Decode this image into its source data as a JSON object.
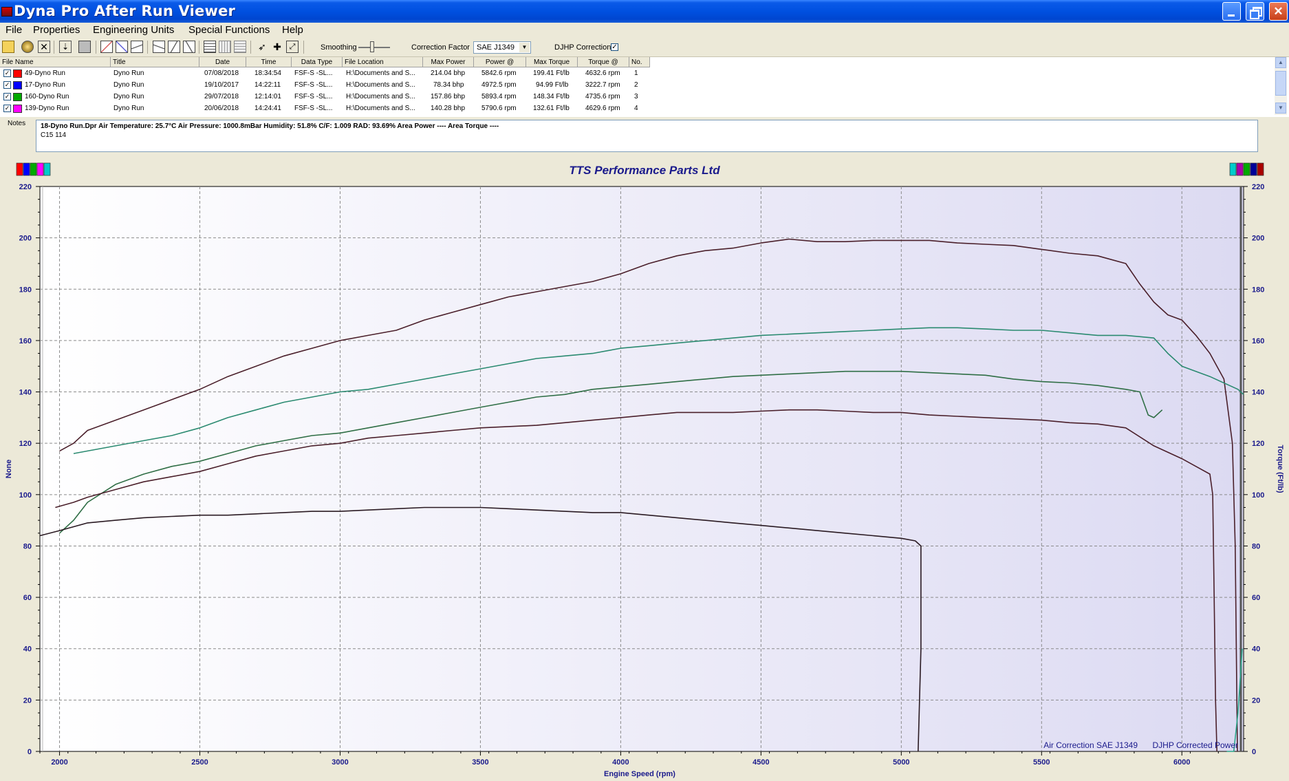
{
  "window": {
    "title": "Dyna Pro After Run Viewer",
    "minimize_glyph": "_",
    "close_glyph": "✕"
  },
  "menu": [
    {
      "label": "File"
    },
    {
      "label": "Properties"
    },
    {
      "label": "Engineering Units"
    },
    {
      "label": "Special Functions"
    },
    {
      "label": "Help"
    }
  ],
  "toolbar": {
    "smoothing_label": "Smoothing",
    "smoothing_level": 0.4,
    "correction_factor_label": "Correction Factor",
    "correction_factor_value": "SAE J1349",
    "combo_arrow": "▼",
    "djhp_label": "DJHP Correction",
    "djhp_checked": "✓",
    "icons": [
      "open-folder-icon",
      "disk-icon",
      "close-x-icon",
      "import-icon",
      "print-icon",
      "graph-icon",
      "graph-2-icon",
      "graph-3-icon",
      "graph-4-icon",
      "graph-5-icon",
      "graph-6-icon",
      "list-icon",
      "grid-icon",
      "grid-2-icon",
      "pointer-icon",
      "cross-icon",
      "zoom-icon"
    ]
  },
  "run_table": {
    "columns": [
      "File Name",
      "Title",
      "Date",
      "Time",
      "Data Type",
      "File Location",
      "Max Power",
      "Power @",
      "Max Torque",
      "Torque @",
      "No."
    ],
    "check_glyph": "✓",
    "rows": [
      {
        "file": "49-Dyno Run",
        "title": "Dyno Run",
        "date": "07/08/2018",
        "time": "18:34:54",
        "type": "FSF-S -SL...",
        "location": "H:\\Documents and S...",
        "max_power": "214.04 bhp",
        "power_at": "5842.6 rpm",
        "max_torque": "199.41 Ft/lb",
        "torque_at": "4632.6 rpm",
        "no": "1",
        "color": "#ff0000"
      },
      {
        "file": "17-Dyno Run",
        "title": "Dyno Run",
        "date": "19/10/2017",
        "time": "14:22:11",
        "type": "FSF-S -SL...",
        "location": "H:\\Documents and S...",
        "max_power": "78.34 bhp",
        "power_at": "4972.5 rpm",
        "max_torque": "94.99 Ft/lb",
        "torque_at": "3222.7 rpm",
        "no": "2",
        "color": "#0000ff"
      },
      {
        "file": "160-Dyno Run",
        "title": "Dyno Run",
        "date": "29/07/2018",
        "time": "12:14:01",
        "type": "FSF-S -SL...",
        "location": "H:\\Documents and S...",
        "max_power": "157.86 bhp",
        "power_at": "5893.4 rpm",
        "max_torque": "148.34 Ft/lb",
        "torque_at": "4735.6 rpm",
        "no": "3",
        "color": "#00aa00"
      },
      {
        "file": "139-Dyno Run",
        "title": "Dyno Run",
        "date": "20/06/2018",
        "time": "14:24:41",
        "type": "FSF-S -SL...",
        "location": "H:\\Documents and S...",
        "max_power": "140.28 bhp",
        "power_at": "5790.6 rpm",
        "max_torque": "132.61 Ft/lb",
        "torque_at": "4629.6 rpm",
        "no": "4",
        "color": "#ff00ff"
      }
    ]
  },
  "notes": {
    "label": "Notes",
    "line1": "18-Dyno Run.Dpr   Air Temperature: 25.7°C    Air Pressure: 1000.8mBar    Humidity: 51.8%    C/F: 1.009    RAD: 93.69%   Area Power ----    Area Torque ----",
    "line2": "C15 114"
  },
  "colors": {
    "left_swatches": [
      "#ff0000",
      "#0000ff",
      "#00aa00",
      "#ff00ff",
      "#00cccc"
    ],
    "right_swatches": [
      "#00cccc",
      "#aa00aa",
      "#00aa00",
      "#000099",
      "#aa0000"
    ],
    "title_blue": "#1a1a8c",
    "curve_power_1": "#4a1f2a",
    "curve_power_3": "#2a8a70",
    "curve_power_4": "#2f6e45",
    "curve_torque_1": "#4a1f2a",
    "curve_power_2": "#2a1a22",
    "curve_right_tail": "#2aa58a"
  },
  "chart_data": {
    "type": "line",
    "title": "TTS Performance Parts Ltd",
    "xlabel": "Engine Speed (rpm)",
    "ylabel": "None",
    "y2label": "Torque (Ft/lb)",
    "xlim": [
      1930,
      6220
    ],
    "ylim": [
      0,
      220
    ],
    "xticks": [
      2000,
      2500,
      3000,
      3500,
      4000,
      4500,
      5000,
      5500,
      6000
    ],
    "yticks": [
      0,
      20,
      40,
      60,
      80,
      100,
      120,
      140,
      160,
      180,
      200,
      220
    ],
    "grid": true,
    "footer_left": "Air Correction SAE J1349",
    "footer_right": "DJHP Corrected Power",
    "series": [
      {
        "color_key": "curve_power_1",
        "points": [
          [
            2000,
            117
          ],
          [
            2050,
            120
          ],
          [
            2100,
            125
          ],
          [
            2200,
            129
          ],
          [
            2300,
            133
          ],
          [
            2400,
            137
          ],
          [
            2500,
            141
          ],
          [
            2600,
            146
          ],
          [
            2700,
            150
          ],
          [
            2800,
            154
          ],
          [
            2900,
            157
          ],
          [
            3000,
            160
          ],
          [
            3100,
            162
          ],
          [
            3200,
            164
          ],
          [
            3300,
            168
          ],
          [
            3400,
            171
          ],
          [
            3500,
            174
          ],
          [
            3600,
            177
          ],
          [
            3700,
            179
          ],
          [
            3800,
            181
          ],
          [
            3900,
            183
          ],
          [
            4000,
            186
          ],
          [
            4100,
            190
          ],
          [
            4200,
            193
          ],
          [
            4300,
            195
          ],
          [
            4400,
            196
          ],
          [
            4500,
            198
          ],
          [
            4600,
            199.5
          ],
          [
            4700,
            198.5
          ],
          [
            4800,
            198.5
          ],
          [
            4900,
            199
          ],
          [
            5000,
            199
          ],
          [
            5100,
            199
          ],
          [
            5200,
            198
          ],
          [
            5300,
            197.5
          ],
          [
            5400,
            197
          ],
          [
            5500,
            195.5
          ],
          [
            5600,
            194
          ],
          [
            5700,
            193
          ],
          [
            5800,
            190
          ],
          [
            5850,
            182
          ],
          [
            5900,
            175
          ],
          [
            5950,
            170
          ],
          [
            6000,
            168
          ],
          [
            6050,
            162
          ],
          [
            6100,
            155
          ],
          [
            6150,
            145
          ],
          [
            6180,
            120
          ],
          [
            6190,
            80
          ],
          [
            6195,
            30
          ],
          [
            6198,
            0
          ]
        ]
      },
      {
        "color_key": "curve_power_3",
        "points": [
          [
            2050,
            116
          ],
          [
            2100,
            117
          ],
          [
            2200,
            119
          ],
          [
            2300,
            121
          ],
          [
            2400,
            123
          ],
          [
            2500,
            126
          ],
          [
            2600,
            130
          ],
          [
            2700,
            133
          ],
          [
            2800,
            136
          ],
          [
            2900,
            138
          ],
          [
            3000,
            140
          ],
          [
            3100,
            141
          ],
          [
            3200,
            143
          ],
          [
            3300,
            145
          ],
          [
            3400,
            147
          ],
          [
            3500,
            149
          ],
          [
            3600,
            151
          ],
          [
            3700,
            153
          ],
          [
            3800,
            154
          ],
          [
            3900,
            155
          ],
          [
            4000,
            157
          ],
          [
            4100,
            158
          ],
          [
            4200,
            159
          ],
          [
            4300,
            160
          ],
          [
            4400,
            161
          ],
          [
            4500,
            162
          ],
          [
            4600,
            162.5
          ],
          [
            4700,
            163
          ],
          [
            4800,
            163.5
          ],
          [
            4900,
            164
          ],
          [
            5000,
            164.5
          ],
          [
            5100,
            165
          ],
          [
            5200,
            165
          ],
          [
            5300,
            164.5
          ],
          [
            5400,
            164
          ],
          [
            5500,
            164
          ],
          [
            5600,
            163
          ],
          [
            5700,
            162
          ],
          [
            5800,
            162
          ],
          [
            5900,
            161
          ],
          [
            5950,
            155
          ],
          [
            6000,
            150
          ],
          [
            6100,
            146
          ],
          [
            6200,
            141
          ],
          [
            6220,
            139
          ]
        ]
      },
      {
        "color_key": "curve_power_4",
        "points": [
          [
            2000,
            85
          ],
          [
            2050,
            90
          ],
          [
            2100,
            97
          ],
          [
            2200,
            104
          ],
          [
            2300,
            108
          ],
          [
            2400,
            111
          ],
          [
            2500,
            113
          ],
          [
            2600,
            116
          ],
          [
            2700,
            119
          ],
          [
            2800,
            121
          ],
          [
            2900,
            123
          ],
          [
            3000,
            124
          ],
          [
            3100,
            126
          ],
          [
            3200,
            128
          ],
          [
            3300,
            130
          ],
          [
            3400,
            132
          ],
          [
            3500,
            134
          ],
          [
            3600,
            136
          ],
          [
            3700,
            138
          ],
          [
            3800,
            139
          ],
          [
            3900,
            141
          ],
          [
            4000,
            142
          ],
          [
            4100,
            143
          ],
          [
            4200,
            144
          ],
          [
            4300,
            145
          ],
          [
            4400,
            146
          ],
          [
            4500,
            146.5
          ],
          [
            4600,
            147
          ],
          [
            4700,
            147.5
          ],
          [
            4800,
            148
          ],
          [
            4900,
            148
          ],
          [
            5000,
            148
          ],
          [
            5100,
            147.5
          ],
          [
            5200,
            147
          ],
          [
            5300,
            146.5
          ],
          [
            5400,
            145
          ],
          [
            5500,
            144
          ],
          [
            5600,
            143.5
          ],
          [
            5700,
            142.5
          ],
          [
            5800,
            141
          ],
          [
            5850,
            140
          ],
          [
            5880,
            131
          ],
          [
            5900,
            130
          ],
          [
            5930,
            133
          ]
        ]
      },
      {
        "color_key": "curve_torque_1",
        "points": [
          [
            1985,
            95
          ],
          [
            2050,
            97
          ],
          [
            2100,
            99
          ],
          [
            2200,
            102
          ],
          [
            2300,
            105
          ],
          [
            2400,
            107
          ],
          [
            2500,
            109
          ],
          [
            2600,
            112
          ],
          [
            2700,
            115
          ],
          [
            2800,
            117
          ],
          [
            2900,
            119
          ],
          [
            3000,
            120
          ],
          [
            3100,
            122
          ],
          [
            3200,
            123
          ],
          [
            3300,
            124
          ],
          [
            3400,
            125
          ],
          [
            3500,
            126
          ],
          [
            3600,
            126.5
          ],
          [
            3700,
            127
          ],
          [
            3800,
            128
          ],
          [
            3900,
            129
          ],
          [
            4000,
            130
          ],
          [
            4100,
            131
          ],
          [
            4200,
            132
          ],
          [
            4300,
            132
          ],
          [
            4400,
            132
          ],
          [
            4500,
            132.5
          ],
          [
            4600,
            133
          ],
          [
            4700,
            133
          ],
          [
            4800,
            132.5
          ],
          [
            4900,
            132
          ],
          [
            5000,
            132
          ],
          [
            5100,
            131
          ],
          [
            5200,
            130.5
          ],
          [
            5300,
            130
          ],
          [
            5400,
            129.5
          ],
          [
            5500,
            129
          ],
          [
            5600,
            128
          ],
          [
            5700,
            127.5
          ],
          [
            5800,
            126
          ],
          [
            5900,
            119
          ],
          [
            6000,
            114
          ],
          [
            6050,
            111
          ],
          [
            6100,
            108
          ],
          [
            6110,
            100
          ],
          [
            6115,
            60
          ],
          [
            6120,
            20
          ],
          [
            6125,
            0
          ]
        ]
      },
      {
        "color_key": "curve_power_2",
        "points": [
          [
            1930,
            84
          ],
          [
            2000,
            86
          ],
          [
            2100,
            89
          ],
          [
            2200,
            90
          ],
          [
            2300,
            91
          ],
          [
            2400,
            91.5
          ],
          [
            2500,
            92
          ],
          [
            2600,
            92
          ],
          [
            2700,
            92.5
          ],
          [
            2800,
            93
          ],
          [
            2900,
            93.5
          ],
          [
            3000,
            93.5
          ],
          [
            3100,
            94
          ],
          [
            3200,
            94.5
          ],
          [
            3300,
            95
          ],
          [
            3400,
            95
          ],
          [
            3500,
            95
          ],
          [
            3600,
            94.5
          ],
          [
            3700,
            94
          ],
          [
            3800,
            93.5
          ],
          [
            3900,
            93
          ],
          [
            4000,
            93
          ],
          [
            4100,
            92
          ],
          [
            4200,
            91
          ],
          [
            4300,
            90
          ],
          [
            4400,
            89
          ],
          [
            4500,
            88
          ],
          [
            4600,
            87
          ],
          [
            4700,
            86
          ],
          [
            4800,
            85
          ],
          [
            4900,
            84
          ],
          [
            5000,
            83
          ],
          [
            5050,
            82
          ],
          [
            5070,
            80
          ],
          [
            5070,
            40
          ],
          [
            5060,
            0
          ]
        ]
      },
      {
        "color_key": "curve_right_tail",
        "points": [
          [
            6160,
            0
          ],
          [
            6185,
            0
          ],
          [
            6200,
            15
          ],
          [
            6215,
            40
          ]
        ]
      }
    ]
  }
}
